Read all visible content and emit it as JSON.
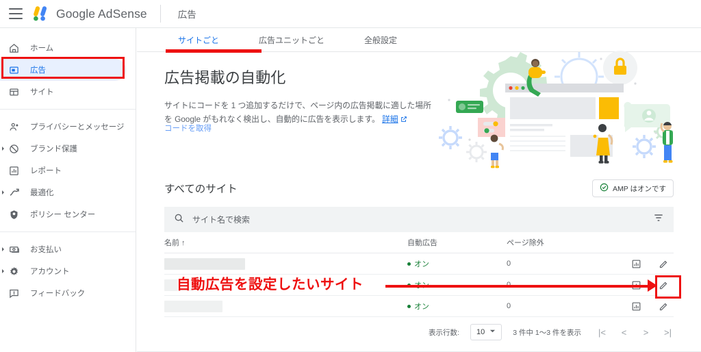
{
  "header": {
    "menu_icon": "hamburger-menu-icon",
    "brand": "Google AdSense",
    "title": "広告"
  },
  "sidebar": {
    "groups": [
      {
        "items": [
          {
            "label": "ホーム",
            "icon": "home-icon",
            "active": false,
            "expandable": false
          },
          {
            "label": "広告",
            "icon": "ads-icon",
            "active": true,
            "expandable": false
          },
          {
            "label": "サイト",
            "icon": "sites-icon",
            "active": false,
            "expandable": false
          }
        ]
      },
      {
        "items": [
          {
            "label": "プライバシーとメッセージ",
            "icon": "privacy-person-icon",
            "active": false,
            "expandable": false
          },
          {
            "label": "ブランド保護",
            "icon": "brand-safety-block-icon",
            "active": false,
            "expandable": true
          },
          {
            "label": "レポート",
            "icon": "reports-bar-chart-icon",
            "active": false,
            "expandable": false
          },
          {
            "label": "最適化",
            "icon": "optimization-trend-icon",
            "active": false,
            "expandable": true
          },
          {
            "label": "ポリシー センター",
            "icon": "policy-shield-icon",
            "active": false,
            "expandable": false
          }
        ]
      },
      {
        "items": [
          {
            "label": "お支払い",
            "icon": "payments-money-icon",
            "active": false,
            "expandable": true
          },
          {
            "label": "アカウント",
            "icon": "account-gear-icon",
            "active": false,
            "expandable": true
          },
          {
            "label": "フィードバック",
            "icon": "feedback-icon",
            "active": false,
            "expandable": false
          }
        ]
      }
    ]
  },
  "tabs": [
    {
      "label": "サイトごと",
      "active": true
    },
    {
      "label": "広告ユニットごと",
      "active": false
    },
    {
      "label": "全般設定",
      "active": false
    }
  ],
  "promo": {
    "heading": "広告掲載の自動化",
    "body": "サイトにコードを 1 つ追加するだけで、ページ内の広告掲載に適した場所を Google がもれなく検出し、自動的に広告を表示します。",
    "body_link": "詳細",
    "cta": "コードを取得",
    "illustration": "auto-ads-browser-illustration"
  },
  "sites": {
    "title": "すべてのサイト",
    "amp_badge": "AMP はオンです",
    "search_placeholder": "サイト名で検索",
    "columns": {
      "name": "名前 ↑",
      "auto_ads": "自動広告",
      "page_exclusions": "ページ除外"
    },
    "rows": [
      {
        "name": "",
        "name_width": 118,
        "auto_ads": "オン",
        "page_exclusions": "0"
      },
      {
        "name": "",
        "name_width": 72,
        "auto_ads": "オン",
        "page_exclusions": "0"
      },
      {
        "name": "",
        "name_width": 85,
        "auto_ads": "オン",
        "page_exclusions": "0"
      }
    ],
    "row_actions": {
      "stats": "stats-bar-chart-icon",
      "edit": "edit-pencil-icon"
    }
  },
  "pagination": {
    "rows_label": "表示行数:",
    "rows_value": "10",
    "range_text": "3 件中 1～3 件を表示",
    "first": "|<",
    "prev": "<",
    "next": ">",
    "last": ">|"
  },
  "annotations": {
    "callout_text": "自動広告を設定したいサイト",
    "color": "#ee1111"
  },
  "colors": {
    "accent_blue": "#1a73e8",
    "active_nav_bg": "#e8f0fe",
    "status_green": "#188038",
    "annotation_red": "#ee1111",
    "text_grey": "#5f6368"
  }
}
